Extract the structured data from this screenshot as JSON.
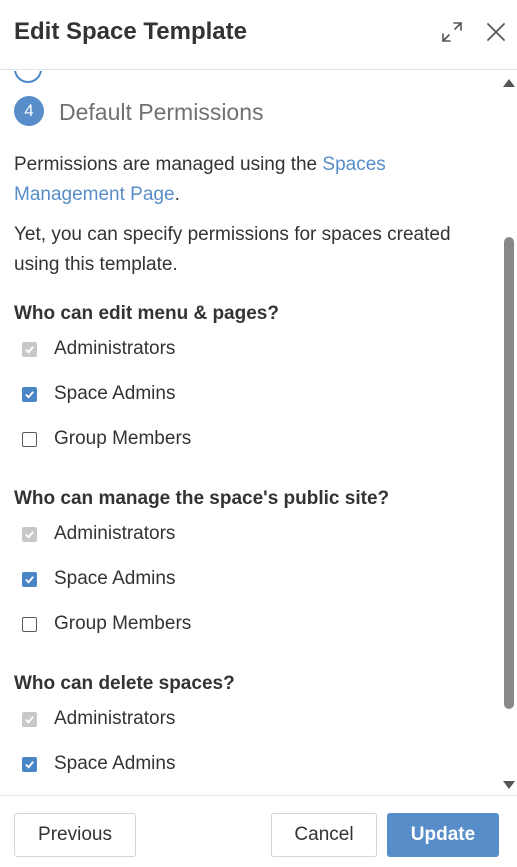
{
  "header": {
    "title": "Edit Space Template",
    "expand_icon": "expand-icon",
    "close_icon": "close-icon"
  },
  "step": {
    "number": "4",
    "label": "Default Permissions"
  },
  "intro": {
    "text_before_link": "Permissions are managed using the ",
    "link_text": "Spaces Management Page",
    "text_after_link": ".",
    "note": "Yet, you can specify permissions for spaces created using this template."
  },
  "sections": [
    {
      "title": "Who can edit menu & pages?",
      "options": [
        {
          "label": "Administrators",
          "state": "checked-disabled"
        },
        {
          "label": "Space Admins",
          "state": "checked"
        },
        {
          "label": "Group Members",
          "state": "unchecked"
        }
      ]
    },
    {
      "title": "Who can manage the space's public site?",
      "options": [
        {
          "label": "Administrators",
          "state": "checked-disabled"
        },
        {
          "label": "Space Admins",
          "state": "checked"
        },
        {
          "label": "Group Members",
          "state": "unchecked"
        }
      ]
    },
    {
      "title": "Who can delete spaces?",
      "options": [
        {
          "label": "Administrators",
          "state": "checked-disabled"
        },
        {
          "label": "Space Admins",
          "state": "checked"
        }
      ]
    }
  ],
  "footer": {
    "previous_label": "Previous",
    "cancel_label": "Cancel",
    "update_label": "Update"
  },
  "colors": {
    "accent": "#578dc9",
    "checkbox_checked": "#4a86c5",
    "checkbox_disabled": "#c8c8c8"
  }
}
